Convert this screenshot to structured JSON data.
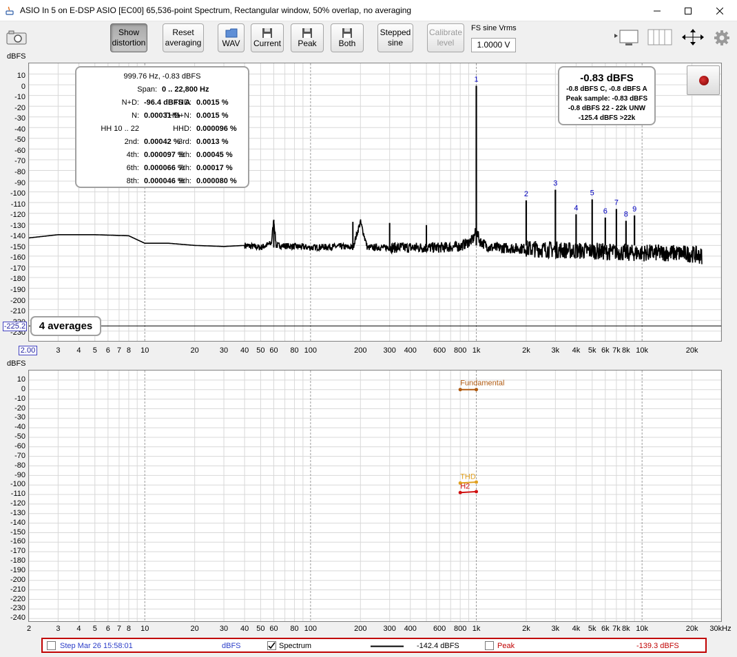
{
  "window": {
    "title": "ASIO In 5 on E-DSP ASIO [EC00] 65,536-point Spectrum, Rectangular window, 50% overlap, no averaging"
  },
  "toolbar": {
    "show_distortion": [
      "Show",
      "distortion"
    ],
    "reset_averaging": [
      "Reset",
      "averaging"
    ],
    "wav": "WAV",
    "current": "Current",
    "peak": "Peak",
    "both": "Both",
    "stepped_sine": [
      "Stepped",
      "sine"
    ],
    "calibrate_level": [
      "Calibrate",
      "level"
    ],
    "fs_label": "FS sine Vrms",
    "fs_value": "1.0000 V"
  },
  "top_graph": {
    "y_unit": "dBFS",
    "y_ticks": [
      "10",
      "0",
      "-10",
      "-20",
      "-30",
      "-40",
      "-50",
      "-60",
      "-70",
      "-80",
      "-90",
      "-100",
      "-110",
      "-120",
      "-130",
      "-140",
      "-150",
      "-160",
      "-170",
      "-180",
      "-190",
      "-200",
      "-210",
      "-220",
      "-230"
    ],
    "x_ticks": [
      "3",
      "4",
      "5",
      "6",
      "7",
      "8",
      "10",
      "20",
      "30",
      "40",
      "50",
      "60",
      "80",
      "100",
      "200",
      "300",
      "400",
      "600",
      "800",
      "1k",
      "2k",
      "3k",
      "4k",
      "5k",
      "6k",
      "7k",
      "8k",
      "10k",
      "20k"
    ],
    "x_start": "2.00",
    "cursor_value": "-225.2",
    "averages": "4 averages",
    "harmonic_labels": [
      "1",
      "2",
      "3",
      "4",
      "5",
      "6",
      "7",
      "8",
      "9"
    ],
    "colors": {
      "trace": "#000000",
      "harmonic_labels": "#0000c0"
    }
  },
  "stats": {
    "header1": "999.76 Hz, -0.83 dBFS",
    "header2_label": "Span:",
    "header2_value": "0 .. 22,800 Hz",
    "rows": [
      {
        "l1": "N+D:",
        "v1": "-96.4 dBFS A",
        "l2": "THD:",
        "v2": "0.0015 %"
      },
      {
        "l1": "N:",
        "v1": "0.00031 %",
        "l2": "THD+N:",
        "v2": "0.0015 %"
      },
      {
        "l1": "HH 10 .. 22",
        "v1": "",
        "l2": "HHD:",
        "v2": "0.000096 %"
      },
      {
        "l1": "2nd:",
        "v1": "0.00042 %",
        "l2": "3rd:",
        "v2": "0.0013 %"
      },
      {
        "l1": "4th:",
        "v1": "0.000097 %",
        "l2": "5th:",
        "v2": "0.00045 %"
      },
      {
        "l1": "6th:",
        "v1": "0.000066 %",
        "l2": "7th:",
        "v2": "0.00017 %"
      },
      {
        "l1": "8th:",
        "v1": "0.000046 %",
        "l2": "9th:",
        "v2": "0.000080 %"
      }
    ]
  },
  "level": {
    "main": "-0.83 dBFS",
    "lines": [
      "-0.8 dBFS C, -0.8 dBFS A",
      "Peak sample: -0.83 dBFS",
      "-0.8 dBFS 22 - 22k UNW",
      "-125.4 dBFS >22k"
    ]
  },
  "bottom_graph": {
    "y_unit": "dBFS",
    "y_ticks": [
      "10",
      "0",
      "-10",
      "-20",
      "-30",
      "-40",
      "-50",
      "-60",
      "-70",
      "-80",
      "-90",
      "-100",
      "-110",
      "-120",
      "-130",
      "-140",
      "-150",
      "-160",
      "-170",
      "-180",
      "-190",
      "-200",
      "-210",
      "-220",
      "-230",
      "-240"
    ],
    "x_ticks": [
      "2",
      "3",
      "4",
      "5",
      "6",
      "7",
      "8",
      "10",
      "20",
      "30",
      "40",
      "50",
      "60",
      "80",
      "100",
      "200",
      "300",
      "400",
      "600",
      "800",
      "1k",
      "2k",
      "3k",
      "4k",
      "5k",
      "6k",
      "7k",
      "8k",
      "10k",
      "20k",
      "30kHz"
    ],
    "traces": [
      {
        "name": "Fundamental",
        "y": 0,
        "color": "#b05a10"
      },
      {
        "name": "THD",
        "y": -98,
        "color": "#e0a020"
      },
      {
        "name": "H2",
        "y": -107,
        "color": "#d01010"
      }
    ]
  },
  "legend": {
    "step_label": "Step Mar 26 15:58:01",
    "unit": "dBFS",
    "spectrum_label": "Spectrum",
    "spectrum_checked": true,
    "spectrum_value": "-142.4 dBFS",
    "peak_label": "Peak",
    "peak_checked": false,
    "peak_value": "-139.3 dBFS"
  },
  "chart_data": [
    {
      "type": "line",
      "xscale": "log",
      "xlim": [
        2,
        30000
      ],
      "ylim": [
        -240,
        20
      ],
      "ylabel": "dBFS",
      "grid": true,
      "series": [
        {
          "name": "Spectrum",
          "x": [
            2,
            3,
            5,
            8,
            10,
            14,
            20,
            30,
            40,
            50,
            58,
            60,
            62,
            80,
            100,
            150,
            180,
            200,
            220,
            300,
            400,
            600,
            800,
            950,
            990,
            1000,
            1010,
            1050,
            1200,
            2000,
            3000,
            4000,
            5000,
            6000,
            7000,
            8000,
            9000,
            10000,
            15000,
            20000,
            23000
          ],
          "y": [
            -143,
            -140,
            -140,
            -141,
            -148,
            -148,
            -150,
            -151,
            -150,
            -152,
            -148,
            -126,
            -150,
            -151,
            -152,
            -151,
            -152,
            -128,
            -152,
            -152,
            -152,
            -152,
            -151,
            -145,
            -138,
            -1,
            -138,
            -146,
            -152,
            -153,
            -154,
            -155,
            -155,
            -156,
            -156,
            -157,
            -157,
            -157,
            -157,
            -158,
            -160
          ]
        }
      ],
      "harmonics": [
        {
          "label": "1",
          "freq": 1000,
          "level": -1
        },
        {
          "label": "2",
          "freq": 2000,
          "level": -108
        },
        {
          "label": "3",
          "freq": 3000,
          "level": -98
        },
        {
          "label": "4",
          "freq": 4000,
          "level": -121
        },
        {
          "label": "5",
          "freq": 5000,
          "level": -107
        },
        {
          "label": "6",
          "freq": 6000,
          "level": -124
        },
        {
          "label": "7",
          "freq": 7000,
          "level": -116
        },
        {
          "label": "8",
          "freq": 8000,
          "level": -127
        },
        {
          "label": "9",
          "freq": 9000,
          "level": -122
        }
      ],
      "spurs": [
        {
          "freq": 60,
          "level": -126
        },
        {
          "freq": 180,
          "level": -128
        },
        {
          "freq": 300,
          "level": -129
        },
        {
          "freq": 500,
          "level": -131
        }
      ]
    },
    {
      "type": "line",
      "xscale": "log",
      "xlim": [
        2,
        30000
      ],
      "ylim": [
        -240,
        20
      ],
      "ylabel": "dBFS",
      "series": [
        {
          "name": "Fundamental",
          "x": [
            800,
            1000
          ],
          "y": [
            0,
            0
          ]
        },
        {
          "name": "THD",
          "x": [
            800,
            1000
          ],
          "y": [
            -98,
            -97
          ]
        },
        {
          "name": "H2",
          "x": [
            800,
            1000
          ],
          "y": [
            -108,
            -107
          ]
        }
      ]
    }
  ]
}
